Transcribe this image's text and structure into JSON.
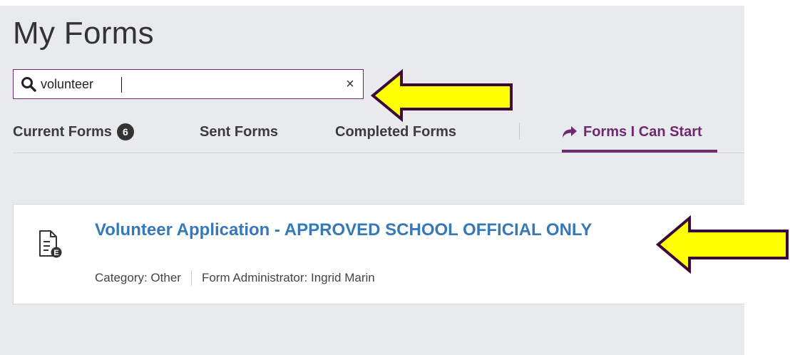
{
  "page": {
    "title": "My Forms"
  },
  "search": {
    "value": "volunteer",
    "clear_label": "×"
  },
  "tabs": [
    {
      "label": "Current Forms",
      "badge": "6"
    },
    {
      "label": "Sent Forms"
    },
    {
      "label": "Completed Forms"
    },
    {
      "label": "Forms I Can Start",
      "active": true
    }
  ],
  "result": {
    "title": "Volunteer Application - APPROVED SCHOOL OFFICIAL ONLY",
    "category": "Category: Other",
    "administrator": "Form Administrator: Ingrid Marin",
    "icon_badge": "E"
  },
  "colors": {
    "accent": "#6d2b6f",
    "link": "#3679b8",
    "panel_bg": "#e8eaed",
    "arrow_fill": "#ffff00",
    "arrow_stroke": "#3a0a3a"
  },
  "icons": {
    "search": "search-icon",
    "share": "share-arrow-icon",
    "document": "document-e-icon",
    "annotation": "yellow-arrow-icon"
  }
}
